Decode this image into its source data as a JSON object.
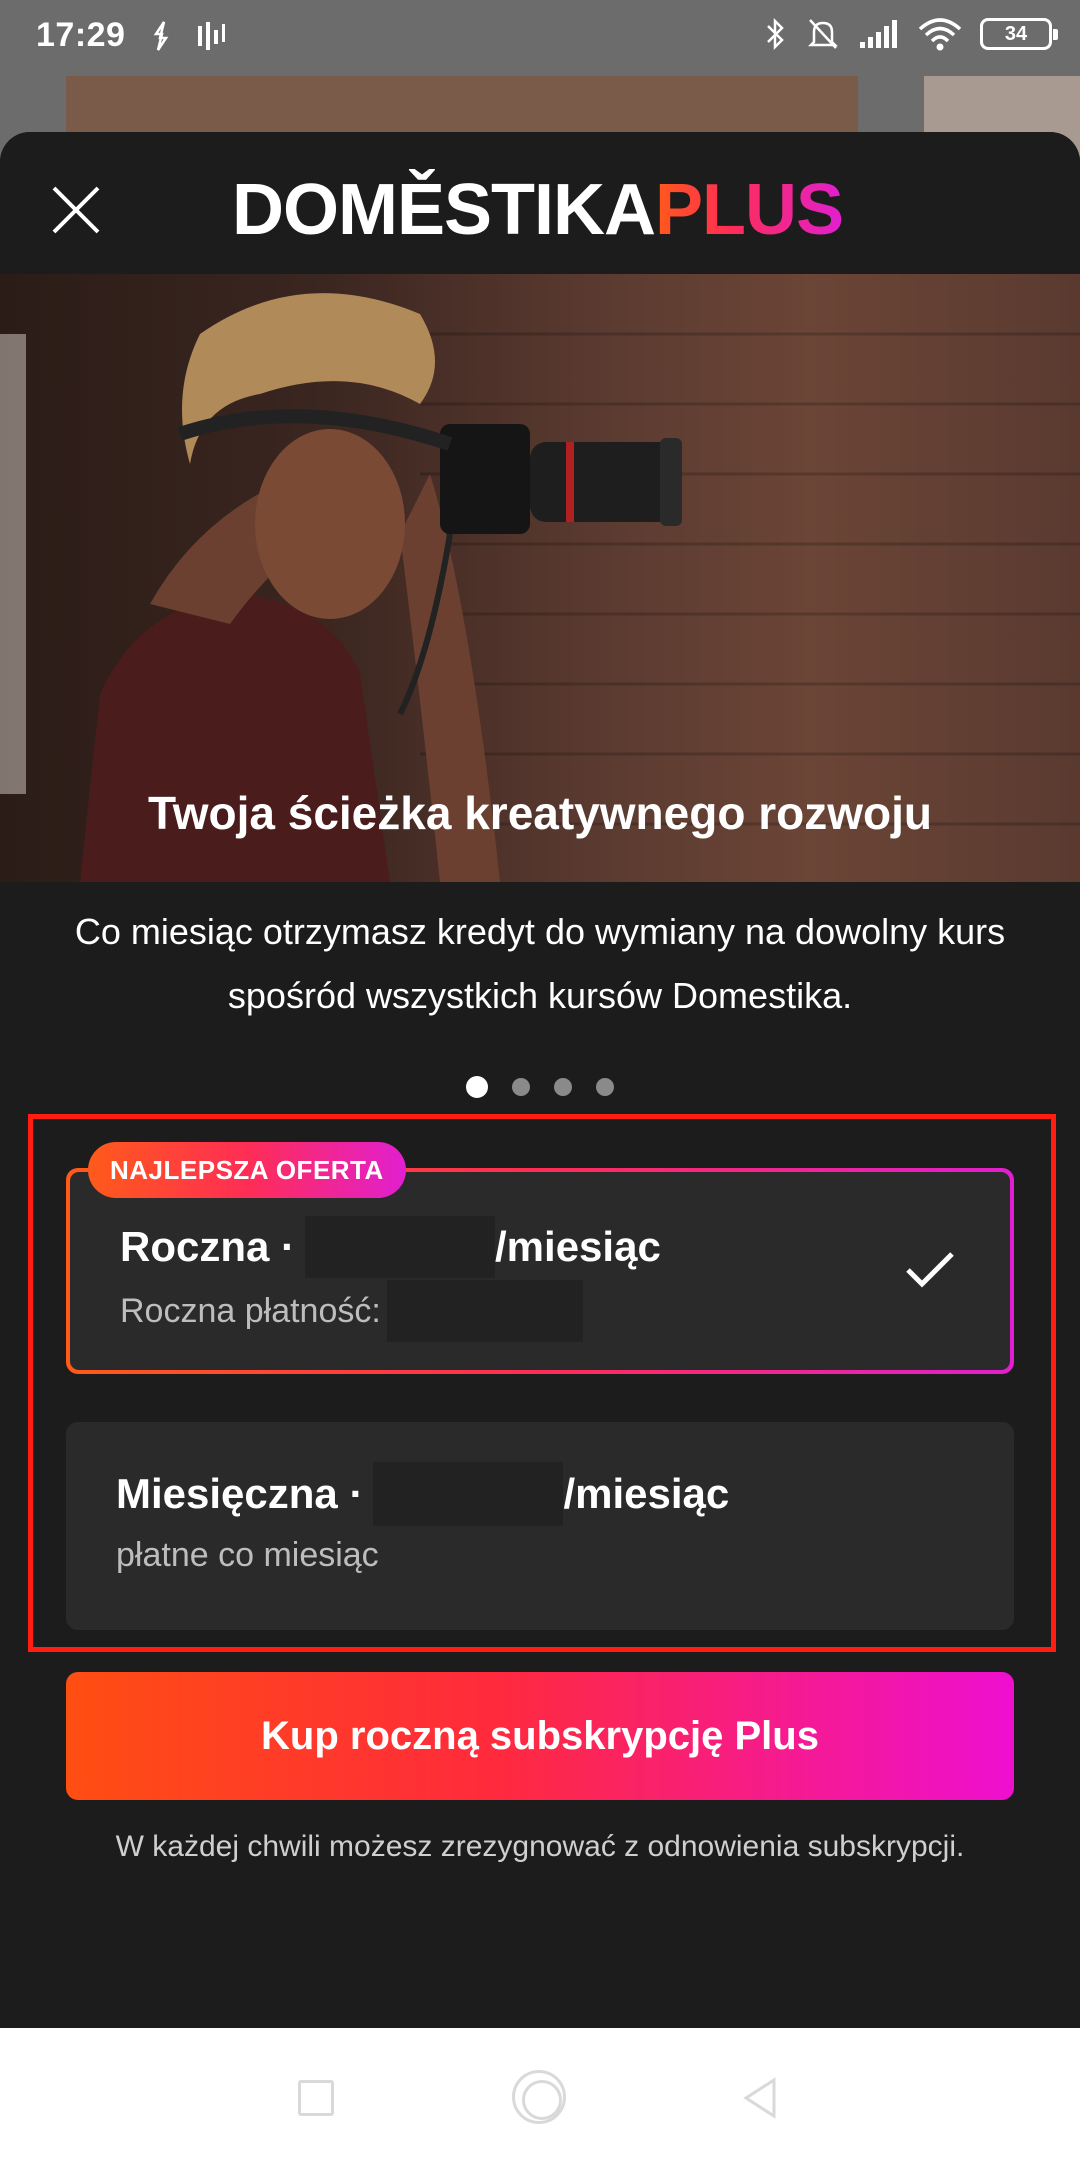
{
  "status_bar": {
    "time": "17:29",
    "battery": "34",
    "icons": [
      "sync-icon",
      "audio-bars-icon",
      "bluetooth-icon",
      "bell-off-icon",
      "signal-icon",
      "wifi-icon",
      "battery-icon"
    ]
  },
  "header": {
    "logo_main": "DOMĚSTIKA",
    "logo_plus": "PLUS"
  },
  "hero": {
    "image": "photographer-with-camera"
  },
  "content": {
    "title": "Twoja ścieżka kreatywnego rozwoju",
    "description": "Co miesiąc otrzymasz kredyt do wymiany na dowolny kurs spośród wszystkich kursów Domestika.",
    "carousel": {
      "total": 4,
      "active": 1
    }
  },
  "plans": {
    "badge": "NAJLEPSZA OFERTA",
    "annual": {
      "name": "Roczna ·",
      "per_month_suffix": "/miesiąc",
      "billing_label": "Roczna płatność:",
      "selected": true
    },
    "monthly": {
      "name": "Miesięczna ·",
      "per_month_suffix": "/miesiąc",
      "billing_label": "płatne co miesiąc",
      "selected": false
    }
  },
  "cta": {
    "label": "Kup roczną subskrypcję Plus"
  },
  "footnote": "W każdej chwili możesz zrezygnować z odnowienia subskrypcji.",
  "colors": {
    "gradient_start": "#ff5a1a",
    "gradient_mid": "#ff2d55",
    "gradient_end": "#e11fd0",
    "highlight_frame": "#ff1e10",
    "sheet_bg": "#1c1c1c",
    "card_bg": "#2a2a2a"
  }
}
